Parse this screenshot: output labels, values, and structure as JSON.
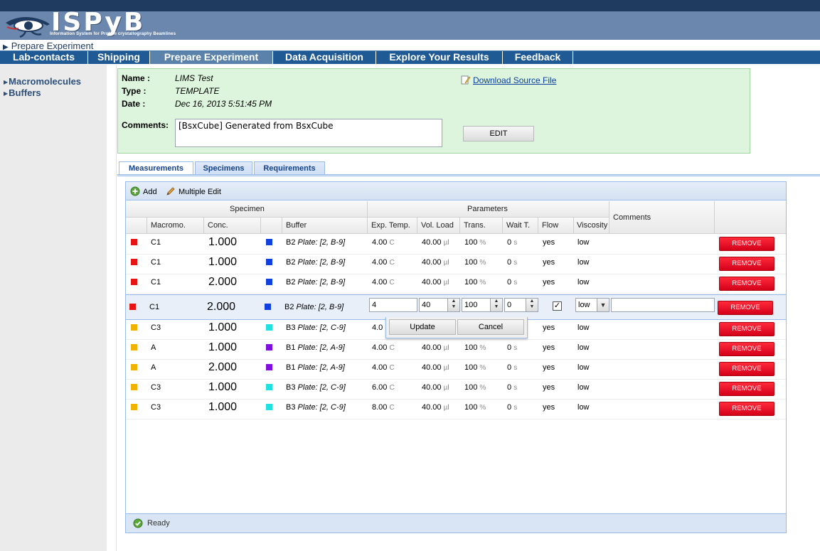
{
  "app": {
    "logo_text": "ISPyB",
    "logo_subtitle": "Information System for Protein crystallography Beamlines",
    "breadcrumb": "Prepare Experiment"
  },
  "nav": {
    "items": [
      "Lab-contacts",
      "Shipping",
      "Prepare Experiment",
      "Data Acquisition",
      "Explore Your Results",
      "Feedback"
    ],
    "active": "Prepare Experiment"
  },
  "sidebar": {
    "items": [
      "Macromolecules",
      "Buffers"
    ]
  },
  "info": {
    "name_label": "Name :",
    "name_value": "LIMS Test",
    "type_label": "Type :",
    "type_value": "TEMPLATE",
    "date_label": "Date :",
    "date_value": "Dec 16, 2013 5:51:45 PM",
    "comments_label": "Comments:",
    "comments_value": "[BsxCube] Generated from BsxCube",
    "edit_label": "EDIT",
    "download_label": "Download Source File"
  },
  "tabs": [
    "Measurements",
    "Specimens",
    "Requirements"
  ],
  "toolbar": {
    "add_label": "Add",
    "multiple_edit_label": "Multiple Edit"
  },
  "grid": {
    "group_headers": {
      "specimen": "Specimen",
      "parameters": "Parameters",
      "comments": "Comments"
    },
    "columns": {
      "macromo": "Macromo.",
      "conc": "Conc.",
      "buffer": "Buffer",
      "exp_temp": "Exp. Temp.",
      "vol_load": "Vol. Load",
      "trans": "Trans.",
      "wait": "Wait T.",
      "flow": "Flow",
      "viscosity": "Viscosity"
    },
    "units": {
      "temp": "C",
      "vol": "µl",
      "trans": "%",
      "wait": "s"
    },
    "remove_label": "REMOVE",
    "rows": [
      {
        "color": "#e81313",
        "macro": "C1",
        "conc": "1.000",
        "buffer_color": "#1040e0",
        "buffer": "B2",
        "plate": "Plate: [2, B-9]",
        "temp": "4.00",
        "vol": "40.00",
        "trans": "100",
        "wait": "0",
        "flow": "yes",
        "viscosity": "low"
      },
      {
        "color": "#e81313",
        "macro": "C1",
        "conc": "1.000",
        "buffer_color": "#1040e0",
        "buffer": "B2",
        "plate": "Plate: [2, B-9]",
        "temp": "4.00",
        "vol": "40.00",
        "trans": "100",
        "wait": "0",
        "flow": "yes",
        "viscosity": "low"
      },
      {
        "color": "#e81313",
        "macro": "C1",
        "conc": "2.000",
        "buffer_color": "#1040e0",
        "buffer": "B2",
        "plate": "Plate: [2, B-9]",
        "temp": "4.00",
        "vol": "40.00",
        "trans": "100",
        "wait": "0",
        "flow": "yes",
        "viscosity": "low"
      },
      {
        "color": "#e81313",
        "macro": "C1",
        "conc": "2.000",
        "buffer_color": "#1040e0",
        "buffer": "B2",
        "plate": "Plate: [2, B-9]",
        "edit": true,
        "temp_input": "4",
        "vol_input": "40",
        "trans_input": "100",
        "wait_input": "0",
        "viscosity_input": "low"
      },
      {
        "color": "#f0b400",
        "macro": "C3",
        "conc": "1.000",
        "buffer_color": "#20e0e0",
        "buffer": "B3",
        "plate": "Plate: [2, C-9]",
        "temp": "4.0",
        "vol": "",
        "trans": "",
        "wait": "",
        "flow": "yes",
        "viscosity": "low"
      },
      {
        "color": "#f0b400",
        "macro": "A",
        "conc": "1.000",
        "buffer_color": "#8010e0",
        "buffer": "B1",
        "plate": "Plate: [2, A-9]",
        "temp": "4.00",
        "vol": "40.00",
        "trans": "100",
        "wait": "0",
        "flow": "yes",
        "viscosity": "low"
      },
      {
        "color": "#f0b400",
        "macro": "A",
        "conc": "2.000",
        "buffer_color": "#8010e0",
        "buffer": "B1",
        "plate": "Plate: [2, A-9]",
        "temp": "4.00",
        "vol": "40.00",
        "trans": "100",
        "wait": "0",
        "flow": "yes",
        "viscosity": "low"
      },
      {
        "color": "#f0b400",
        "macro": "C3",
        "conc": "1.000",
        "buffer_color": "#20e0e0",
        "buffer": "B3",
        "plate": "Plate: [2, C-9]",
        "temp": "6.00",
        "vol": "40.00",
        "trans": "100",
        "wait": "0",
        "flow": "yes",
        "viscosity": "low"
      },
      {
        "color": "#f0b400",
        "macro": "C3",
        "conc": "1.000",
        "buffer_color": "#20e0e0",
        "buffer": "B3",
        "plate": "Plate: [2, C-9]",
        "temp": "8.00",
        "vol": "40.00",
        "trans": "100",
        "wait": "0",
        "flow": "yes",
        "viscosity": "low"
      }
    ]
  },
  "popup": {
    "update_label": "Update",
    "cancel_label": "Cancel"
  },
  "status": {
    "text": "Ready"
  },
  "colors": {
    "nav_bg": "#1f5a94",
    "banner_bg": "#6b87ad",
    "info_bg": "#dcf5dc",
    "remove_red": "#e8001c"
  }
}
